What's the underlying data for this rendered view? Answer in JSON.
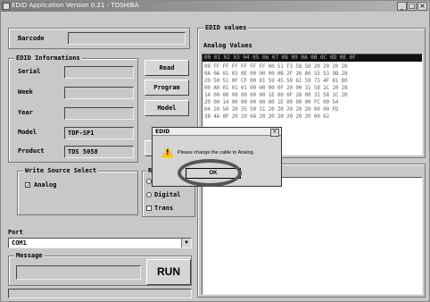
{
  "window": {
    "title": "EDID Application Version 0.21 - TOSHIBA",
    "controls": {
      "minimize": "_",
      "maximize": "□",
      "close": "×"
    }
  },
  "left": {
    "barcode_label": "Barcode",
    "barcode_value": "",
    "edid_group_title": "EDID Informations",
    "serial_label": "Serial",
    "week_label": "Week",
    "year_label": "Year",
    "model_label": "Model",
    "model_value": "TDP-SP1",
    "product_label": "Product",
    "product_value": "TDS 5058",
    "read_btn": "Read",
    "program_btn": "Program",
    "model_btn": "Model",
    "write_group_title": "Write Source Select",
    "analog_label": "Analog",
    "analog_checked": true,
    "right_group_title_fragment": "Re",
    "digital_label": "Digital",
    "trans_label": "Trans",
    "port_label": "Port",
    "port_value": "COM1",
    "message_label": "Message",
    "run_btn": "RUN"
  },
  "right": {
    "edid_values_title": "EDID values",
    "analog_values_title": "Analog Values",
    "hex_header": "00 01 02 03 04 05 06 07 08 09 0A 0B 0C 0D 0E 0F",
    "hex_rows": [
      "00 FF FF FF FF FF FF 00 51 F3 58 50 20 20 20 20",
      "0A 0A 01 03 0E 00 00 00 0B 2F 26 A0 55 53 9B 28",
      "20 50 51 0F CF 00 81 59 45 59 61 59 71 4F 81 80",
      "00 A0 01 01 01 00 00 00 0F 20 00 31 58 1C 20 28",
      "14 00 00 00 00 00 00 1E 00 0F 28 00 31 58 1C 20",
      "20 00 14 00 00 00 00 00 1E 00 00 00 FC 00 54",
      "04 20 50 20 35 50 31 20 20 20 20 20 00 00 FD",
      "38 4A 0F 20 20 0A 20 20 20 20 20 20 00 62"
    ]
  },
  "dialog": {
    "title": "EDID",
    "message": "Please change the cable to Analog.",
    "ok_btn": "OK",
    "close": "×",
    "warning_icon_mark": "!"
  }
}
